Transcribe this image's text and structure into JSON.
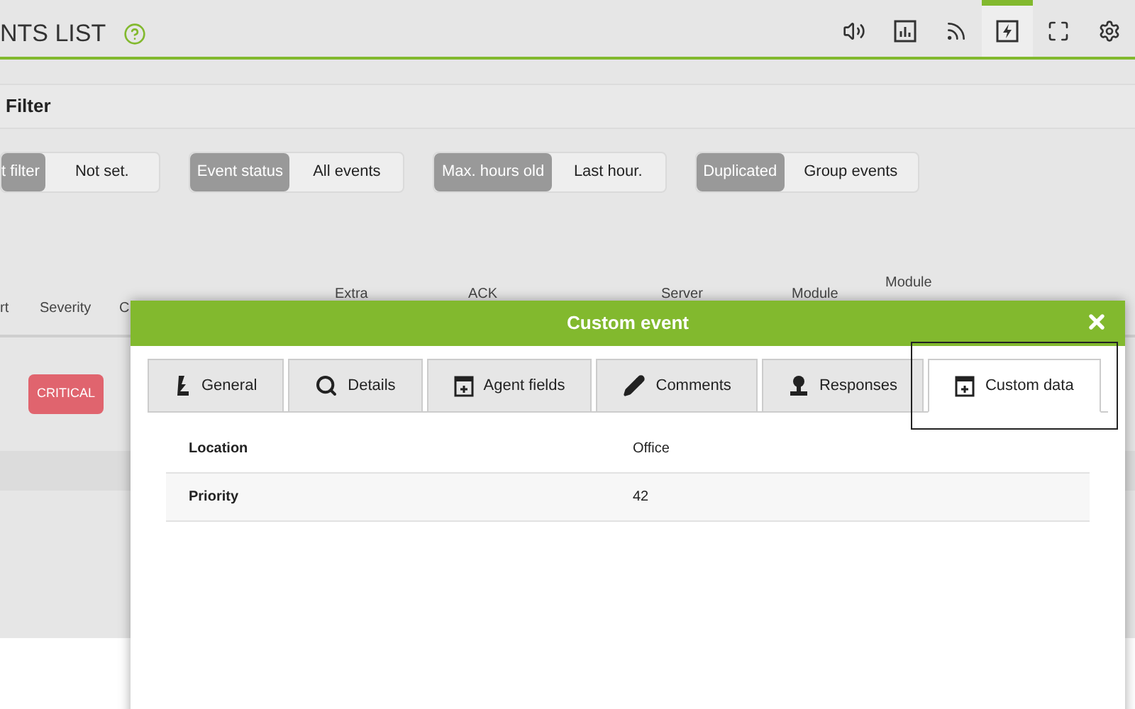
{
  "header": {
    "title": "NTS LIST",
    "toolbar": [
      {
        "kind": "sound",
        "selected": false
      },
      {
        "kind": "chart",
        "selected": false
      },
      {
        "kind": "rss",
        "selected": false
      },
      {
        "kind": "bolt",
        "selected": true
      },
      {
        "kind": "expand",
        "selected": false
      },
      {
        "kind": "gear",
        "selected": false
      }
    ]
  },
  "filter_bar": {
    "label": "Filter"
  },
  "filters": [
    {
      "label": "t filter",
      "value": "Not set."
    },
    {
      "label": "Event status",
      "value": "All events"
    },
    {
      "label": "Max. hours old",
      "value": "Last hour."
    },
    {
      "label": "Duplicated",
      "value": "Group events"
    }
  ],
  "table": {
    "columns": [
      "rt",
      "Severity",
      "C",
      "Extra",
      "ACK",
      "Server",
      "Module",
      "Module"
    ],
    "rows": [
      {
        "severity": "CRITICAL"
      }
    ]
  },
  "dialog": {
    "title": "Custom event",
    "tabs": [
      {
        "label": "General",
        "kind": "general",
        "selected": false,
        "annotated": false
      },
      {
        "label": "Details",
        "kind": "details",
        "selected": false,
        "annotated": false
      },
      {
        "label": "Agent fields",
        "kind": "fields",
        "selected": false,
        "annotated": false
      },
      {
        "label": "Comments",
        "kind": "comments",
        "selected": false,
        "annotated": false
      },
      {
        "label": "Responses",
        "kind": "responses",
        "selected": false,
        "annotated": false
      },
      {
        "label": "Custom data",
        "kind": "fields",
        "selected": true,
        "annotated": true
      }
    ],
    "rows": [
      {
        "key": "Location",
        "value": "Office"
      },
      {
        "key": "Priority",
        "value": "42"
      }
    ]
  }
}
